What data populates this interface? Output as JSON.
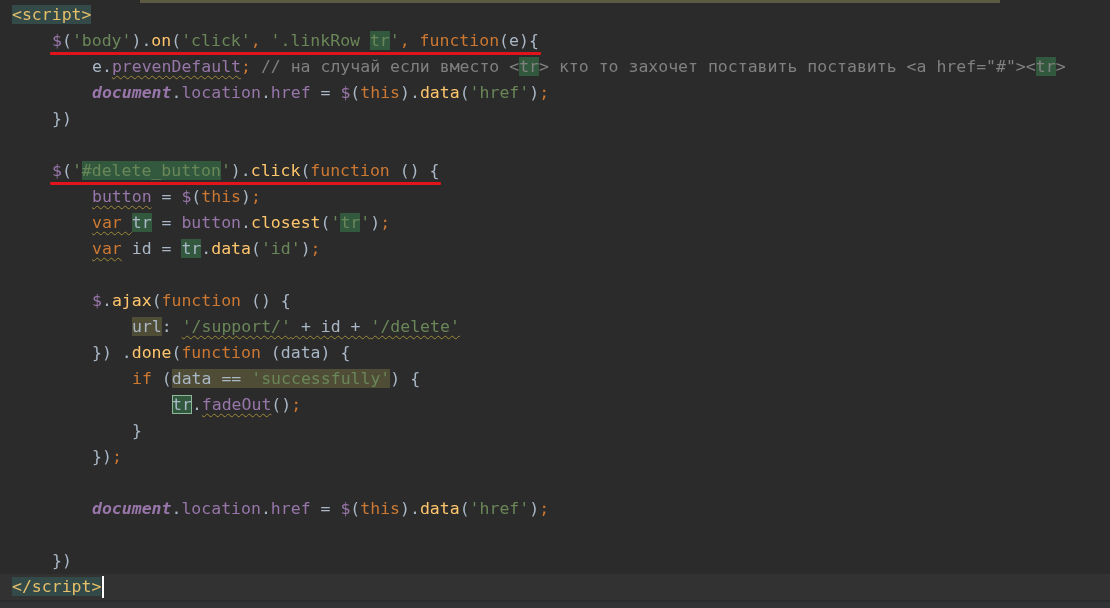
{
  "editor": {
    "lines": [
      {
        "tokens": [
          {
            "kind": "tag",
            "text": "<script>",
            "match": true
          }
        ],
        "children": [
          {
            "underlined": true,
            "tokens": [
              {
                "kind": "dollar",
                "text": "$"
              },
              {
                "kind": "plain",
                "text": "("
              },
              {
                "kind": "string",
                "text": "'body'"
              },
              {
                "kind": "plain",
                "text": ")."
              },
              {
                "kind": "method",
                "text": "on"
              },
              {
                "kind": "plain",
                "text": "("
              },
              {
                "kind": "string",
                "text": "'click'"
              },
              {
                "kind": "keyword",
                "text": ", "
              },
              {
                "kind": "string",
                "text": "'.linkRow "
              },
              {
                "kind": "string",
                "text": "tr",
                "match": true
              },
              {
                "kind": "string",
                "text": "'"
              },
              {
                "kind": "keyword",
                "text": ", function"
              },
              {
                "kind": "plain",
                "text": "(e){"
              }
            ],
            "children": [
              {
                "tokens": [
                  {
                    "kind": "plain",
                    "text": "e."
                  },
                  {
                    "kind": "property",
                    "text": "prevenDefault",
                    "warning": true
                  },
                  {
                    "kind": "keyword",
                    "text": ";"
                  },
                  {
                    "kind": "comment",
                    "text": " // на случай если вместо <"
                  },
                  {
                    "kind": "comment",
                    "text": "tr",
                    "match": true
                  },
                  {
                    "kind": "comment",
                    "text": "> кто то захочет поставить поставить <a href=\"#\"><"
                  },
                  {
                    "kind": "comment",
                    "text": "tr",
                    "match": true
                  },
                  {
                    "kind": "comment",
                    "text": ">"
                  }
                ]
              },
              {
                "tokens": [
                  {
                    "kind": "global",
                    "text": "document"
                  },
                  {
                    "kind": "plain",
                    "text": "."
                  },
                  {
                    "kind": "property",
                    "text": "location"
                  },
                  {
                    "kind": "plain",
                    "text": "."
                  },
                  {
                    "kind": "property",
                    "text": "href"
                  },
                  {
                    "kind": "plain",
                    "text": " = "
                  },
                  {
                    "kind": "dollar",
                    "text": "$"
                  },
                  {
                    "kind": "plain",
                    "text": "("
                  },
                  {
                    "kind": "keyword",
                    "text": "this"
                  },
                  {
                    "kind": "plain",
                    "text": ")."
                  },
                  {
                    "kind": "method",
                    "text": "data"
                  },
                  {
                    "kind": "plain",
                    "text": "("
                  },
                  {
                    "kind": "string",
                    "text": "'href'"
                  },
                  {
                    "kind": "plain",
                    "text": ")"
                  },
                  {
                    "kind": "keyword",
                    "text": ";"
                  }
                ]
              }
            ]
          },
          {
            "tokens": [
              {
                "kind": "plain",
                "text": "})"
              }
            ]
          },
          {
            "blank": true
          },
          {
            "underlined": true,
            "tokens": [
              {
                "kind": "dollar",
                "text": "$"
              },
              {
                "kind": "plain",
                "text": "("
              },
              {
                "kind": "string",
                "text": "'"
              },
              {
                "kind": "string",
                "text": "#delete_button",
                "match": true
              },
              {
                "kind": "string",
                "text": "'"
              },
              {
                "kind": "plain",
                "text": ")."
              },
              {
                "kind": "method",
                "text": "click"
              },
              {
                "kind": "plain",
                "text": "("
              },
              {
                "kind": "keyword",
                "text": "function"
              },
              {
                "kind": "plain",
                "text": " () {"
              }
            ],
            "children": [
              {
                "tokens": [
                  {
                    "kind": "property",
                    "text": "button",
                    "warning": true
                  },
                  {
                    "kind": "plain",
                    "text": " = "
                  },
                  {
                    "kind": "dollar",
                    "text": "$"
                  },
                  {
                    "kind": "plain",
                    "text": "("
                  },
                  {
                    "kind": "keyword",
                    "text": "this"
                  },
                  {
                    "kind": "plain",
                    "text": ")"
                  },
                  {
                    "kind": "keyword",
                    "text": ";"
                  }
                ]
              },
              {
                "tokens": [
                  {
                    "kind": "keyword",
                    "text": "var ",
                    "warning": true
                  },
                  {
                    "kind": "plain",
                    "text": "tr",
                    "match": true
                  },
                  {
                    "kind": "plain",
                    "text": " = "
                  },
                  {
                    "kind": "property",
                    "text": "button"
                  },
                  {
                    "kind": "plain",
                    "text": "."
                  },
                  {
                    "kind": "method",
                    "text": "closest"
                  },
                  {
                    "kind": "plain",
                    "text": "("
                  },
                  {
                    "kind": "string",
                    "text": "'"
                  },
                  {
                    "kind": "string",
                    "text": "tr",
                    "match": true
                  },
                  {
                    "kind": "string",
                    "text": "'"
                  },
                  {
                    "kind": "plain",
                    "text": ")"
                  },
                  {
                    "kind": "keyword",
                    "text": ";"
                  }
                ]
              },
              {
                "tokens": [
                  {
                    "kind": "keyword",
                    "text": "var",
                    "warning": true
                  },
                  {
                    "kind": "plain",
                    "text": " id = "
                  },
                  {
                    "kind": "plain",
                    "text": "tr",
                    "match": true
                  },
                  {
                    "kind": "plain",
                    "text": "."
                  },
                  {
                    "kind": "method",
                    "text": "data"
                  },
                  {
                    "kind": "plain",
                    "text": "("
                  },
                  {
                    "kind": "string",
                    "text": "'id'"
                  },
                  {
                    "kind": "plain",
                    "text": ")"
                  },
                  {
                    "kind": "keyword",
                    "text": ";"
                  }
                ]
              },
              {
                "blank": true
              },
              {
                "tokens": [
                  {
                    "kind": "dollar",
                    "text": "$"
                  },
                  {
                    "kind": "plain",
                    "text": "."
                  },
                  {
                    "kind": "method",
                    "text": "ajax"
                  },
                  {
                    "kind": "plain",
                    "text": "("
                  },
                  {
                    "kind": "keyword",
                    "text": "function"
                  },
                  {
                    "kind": "plain",
                    "text": " () {"
                  }
                ],
                "children": [
                  {
                    "tokens": [
                      {
                        "kind": "plain",
                        "text": "url",
                        "read": true
                      },
                      {
                        "kind": "plain",
                        "text": ": "
                      },
                      {
                        "kind": "string",
                        "text": "'/support/'",
                        "warning": true
                      },
                      {
                        "kind": "plain",
                        "text": " + id + ",
                        "warning": true
                      },
                      {
                        "kind": "string",
                        "text": "'/delete'",
                        "warning": true
                      }
                    ]
                  }
                ]
              },
              {
                "tokens": [
                  {
                    "kind": "plain",
                    "text": "}) ."
                  },
                  {
                    "kind": "method",
                    "text": "done"
                  },
                  {
                    "kind": "plain",
                    "text": "("
                  },
                  {
                    "kind": "keyword",
                    "text": "function"
                  },
                  {
                    "kind": "plain",
                    "text": " (data) {"
                  }
                ],
                "children": [
                  {
                    "tokens": [
                      {
                        "kind": "keyword",
                        "text": "if"
                      },
                      {
                        "kind": "plain",
                        "text": " ("
                      },
                      {
                        "kind": "plain",
                        "text": "data == ",
                        "read": true
                      },
                      {
                        "kind": "string",
                        "text": "'successfully'",
                        "read": true
                      },
                      {
                        "kind": "plain",
                        "text": ") {"
                      }
                    ],
                    "children": [
                      {
                        "tokens": [
                          {
                            "kind": "plain",
                            "text": "tr",
                            "match": true,
                            "boxed": true
                          },
                          {
                            "kind": "plain",
                            "text": "."
                          },
                          {
                            "kind": "property",
                            "text": "fadeOut",
                            "warning": true
                          },
                          {
                            "kind": "plain",
                            "text": "()"
                          },
                          {
                            "kind": "keyword",
                            "text": ";"
                          }
                        ]
                      }
                    ]
                  },
                  {
                    "tokens": [
                      {
                        "kind": "plain",
                        "text": "}"
                      }
                    ]
                  }
                ]
              },
              {
                "tokens": [
                  {
                    "kind": "plain",
                    "text": "})"
                  },
                  {
                    "kind": "keyword",
                    "text": ";"
                  }
                ]
              },
              {
                "blank": true
              },
              {
                "tokens": [
                  {
                    "kind": "global",
                    "text": "document"
                  },
                  {
                    "kind": "plain",
                    "text": "."
                  },
                  {
                    "kind": "property",
                    "text": "location"
                  },
                  {
                    "kind": "plain",
                    "text": "."
                  },
                  {
                    "kind": "property",
                    "text": "href"
                  },
                  {
                    "kind": "plain",
                    "text": " = "
                  },
                  {
                    "kind": "dollar",
                    "text": "$"
                  },
                  {
                    "kind": "plain",
                    "text": "("
                  },
                  {
                    "kind": "keyword",
                    "text": "this"
                  },
                  {
                    "kind": "plain",
                    "text": ")."
                  },
                  {
                    "kind": "method",
                    "text": "data"
                  },
                  {
                    "kind": "plain",
                    "text": "("
                  },
                  {
                    "kind": "string",
                    "text": "'href'"
                  },
                  {
                    "kind": "plain",
                    "text": ")"
                  },
                  {
                    "kind": "keyword",
                    "text": ";"
                  }
                ]
              },
              {
                "blank": true
              }
            ]
          },
          {
            "tokens": [
              {
                "kind": "plain",
                "text": "})"
              }
            ]
          }
        ]
      },
      {
        "current": true,
        "tokens": [
          {
            "kind": "tag",
            "text": "</script>",
            "match": true
          }
        ]
      }
    ]
  }
}
